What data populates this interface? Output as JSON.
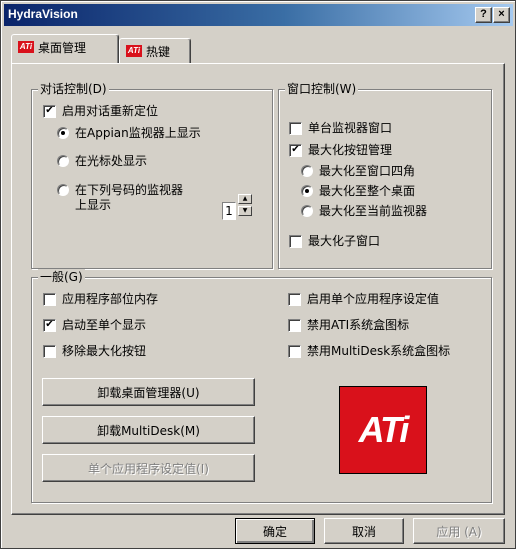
{
  "window": {
    "title": "HydraVision"
  },
  "titlebar": {
    "help_label": "?",
    "close_label": "×"
  },
  "tabs": [
    {
      "label": "桌面管理",
      "active": true
    },
    {
      "label": "热键",
      "active": false
    }
  ],
  "dialog_group": {
    "title": "对话控制(D)",
    "reposition": {
      "label": "启用对话重新定位",
      "checked": true
    },
    "radios": [
      {
        "label": "在Appian监视器上显示",
        "selected": true
      },
      {
        "label": "在光标处显示",
        "selected": false
      },
      {
        "label_line1": "在下列号码的监视器",
        "label_line2": "上显示",
        "selected": false
      }
    ],
    "monitor_number": "1"
  },
  "window_group": {
    "title": "窗口控制(W)",
    "single_monitor": {
      "label": "单台监视器窗口",
      "checked": false
    },
    "maximize_manage": {
      "label": "最大化按钮管理",
      "checked": true
    },
    "radios": [
      {
        "label": "最大化至窗口四角",
        "selected": false
      },
      {
        "label": "最大化至整个桌面",
        "selected": true
      },
      {
        "label": "最大化至当前监视器",
        "selected": false
      }
    ],
    "maximize_child": {
      "label": "最大化子窗口",
      "checked": false
    }
  },
  "general_group": {
    "title": "一般(G)",
    "left_checks": [
      {
        "label": "应用程序部位内存",
        "checked": false
      },
      {
        "label": "启动至单个显示",
        "checked": true
      },
      {
        "label": "移除最大化按钮",
        "checked": false
      }
    ],
    "right_checks": [
      {
        "label": "启用单个应用程序设定值",
        "checked": false
      },
      {
        "label": "禁用ATI系统盒图标",
        "checked": false
      },
      {
        "label": "禁用MultiDesk系统盒图标",
        "checked": false
      }
    ],
    "buttons": {
      "uninstall_desk": "卸载桌面管理器(U)",
      "uninstall_multidesk": "卸载MultiDesk(M)",
      "per_app": "单个应用程序设定值(I)"
    },
    "logo_text": "ATi"
  },
  "footer": {
    "ok": "确定",
    "cancel": "取消",
    "apply": "应用 (A)"
  },
  "marks": {
    "check": "✔"
  }
}
